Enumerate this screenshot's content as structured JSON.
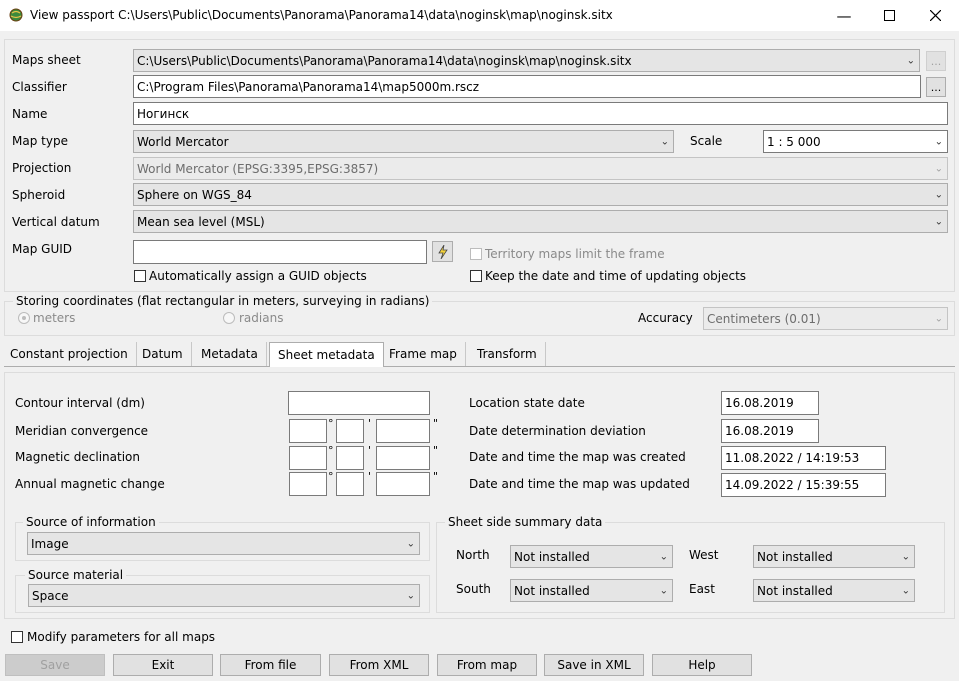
{
  "window": {
    "title": "View passport  C:\\Users\\Public\\Documents\\Panorama\\Panorama14\\data\\noginsk\\map\\noginsk.sitx"
  },
  "form": {
    "maps_sheet": {
      "label": "Maps sheet",
      "value": "C:\\Users\\Public\\Documents\\Panorama\\Panorama14\\data\\noginsk\\map\\noginsk.sitx",
      "btn": "..."
    },
    "classifier": {
      "label": "Classifier",
      "value": "C:\\Program Files\\Panorama\\Panorama14\\map5000m.rscz",
      "btn": "..."
    },
    "name": {
      "label": "Name",
      "value": "Ногинск"
    },
    "map_type": {
      "label": "Map type",
      "value": "World Mercator"
    },
    "scale": {
      "label": "Scale",
      "value": "1 : 5 000"
    },
    "projection": {
      "label": "Projection",
      "value": "World Mercator (EPSG:3395,EPSG:3857)"
    },
    "spheroid": {
      "label": "Spheroid",
      "value": "Sphere on WGS_84"
    },
    "vertical_datum": {
      "label": "Vertical datum",
      "value": "Mean sea level (MSL)"
    },
    "map_guid": {
      "label": "Map GUID",
      "value": ""
    },
    "territory_limit": "Territory maps limit the frame",
    "auto_guid": "Automatically assign a GUID objects",
    "keep_date": "Keep the date and time of updating objects"
  },
  "storing": {
    "title": "Storing coordinates (flat rectangular in meters, surveying in radians)",
    "meters": "meters",
    "radians": "radians",
    "accuracy_label": "Accuracy",
    "accuracy_value": "Centimeters (0.01)"
  },
  "tabs": [
    "Constant projection",
    "Datum",
    "Metadata",
    "Sheet metadata",
    "Frame map",
    "Transform"
  ],
  "sheet": {
    "contour_interval": "Contour interval (dm)",
    "meridian_convergence": "Meridian convergence",
    "magnetic_declination": "Magnetic declination",
    "annual_magnetic_change": "Annual magnetic change",
    "deg": "°",
    "min": "'",
    "sec": "\"",
    "location_state_date": {
      "label": "Location state date",
      "value": "16.08.2019"
    },
    "date_deviation": {
      "label": "Date determination deviation",
      "value": "16.08.2019"
    },
    "created": {
      "label": "Date and time the map was created",
      "value": "11.08.2022 / 14:19:53"
    },
    "updated": {
      "label": "Date and time the map was updated",
      "value": "14.09.2022 / 15:39:55"
    },
    "source_info": {
      "title": "Source of information",
      "value": "Image"
    },
    "source_material": {
      "title": "Source material",
      "value": "Space"
    },
    "summary": {
      "title": "Sheet side summary data",
      "north_label": "North",
      "north_value": "Not installed",
      "west_label": "West",
      "west_value": "Not installed",
      "south_label": "South",
      "south_value": "Not installed",
      "east_label": "East",
      "east_value": "Not installed"
    }
  },
  "modify_all": "Modify parameters for all maps",
  "buttons": {
    "save": "Save",
    "exit": "Exit",
    "from_file": "From file",
    "from_xml": "From XML",
    "from_map": "From map",
    "save_xml": "Save in XML",
    "help": "Help"
  }
}
